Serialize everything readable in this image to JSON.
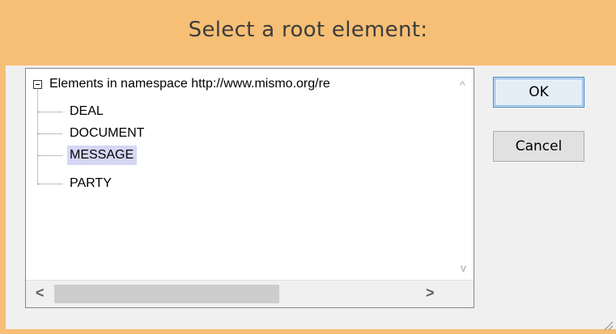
{
  "window": {
    "title": "Select a root element:"
  },
  "tree": {
    "root_label": "Elements in namespace http://www.mismo.org/re",
    "items": [
      {
        "label": "DEAL",
        "selected": false
      },
      {
        "label": "DOCUMENT",
        "selected": false
      },
      {
        "label": "MESSAGE",
        "selected": true
      },
      {
        "label": "PARTY",
        "selected": false
      }
    ]
  },
  "scrollbars": {
    "vertical": {
      "up_arrow": "^",
      "down_arrow": "v"
    },
    "horizontal": {
      "left_arrow": "<",
      "right_arrow": ">"
    }
  },
  "buttons": {
    "ok_label": "OK",
    "cancel_label": "Cancel"
  },
  "colors": {
    "frame": "#f6bf75",
    "selection": "#d6d6f5",
    "client": "#f0f0f0"
  }
}
